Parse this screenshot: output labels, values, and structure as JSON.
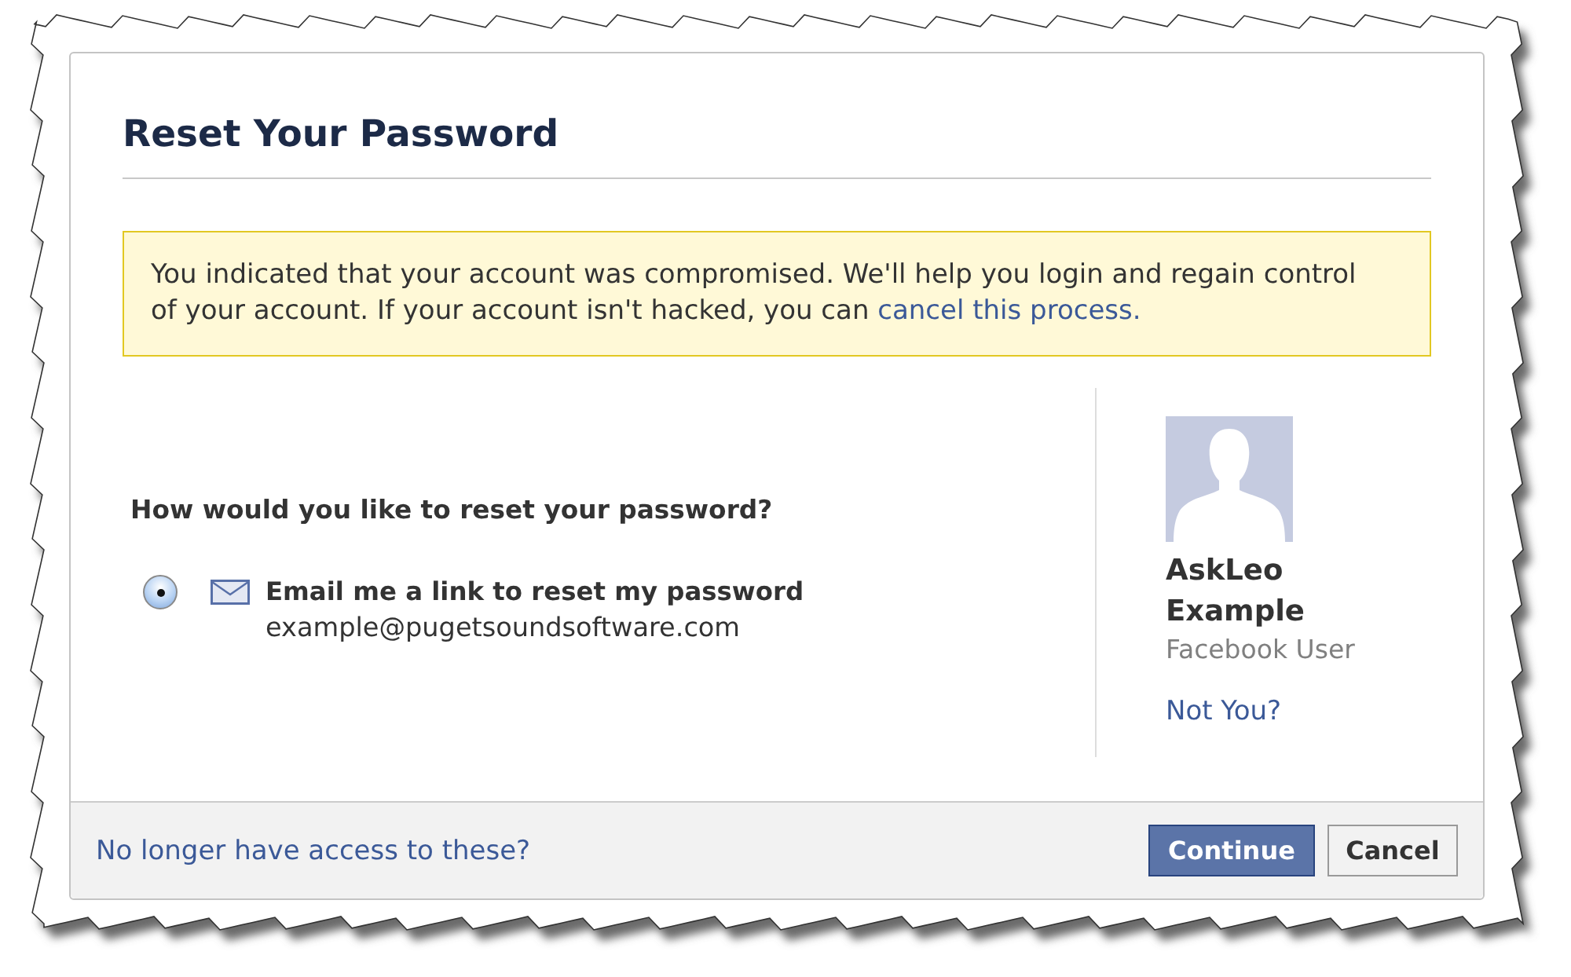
{
  "dialog": {
    "title": "Reset Your Password"
  },
  "notice": {
    "text": "You indicated that your account was compromised. We'll help you login and regain control of your account. If your account isn't hacked, you can",
    "link": "cancel this process."
  },
  "reset_options": {
    "question": "How would you like to reset your password?",
    "options": [
      {
        "kind": "email",
        "label": "Email me a link to reset my password",
        "detail": "example@pugetsoundsoftware.com",
        "selected": true
      }
    ]
  },
  "account": {
    "name": "AskLeo Example",
    "subtitle": "Facebook User",
    "link": "Not You?"
  },
  "footer": {
    "link": "No longer have access to these?",
    "buttons": [
      {
        "kind": "primary",
        "label": "Continue"
      },
      {
        "kind": "secondary",
        "label": "Cancel"
      }
    ]
  }
}
